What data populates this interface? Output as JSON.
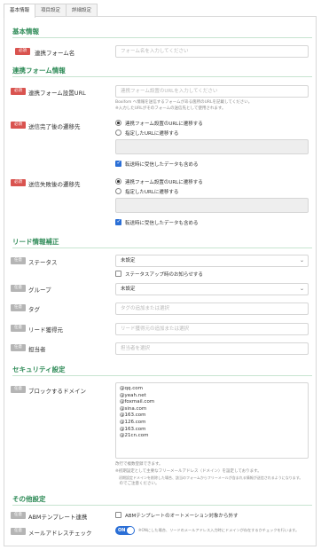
{
  "tabs": [
    "基本情報",
    "項目設定",
    "詳細設定"
  ],
  "badges": {
    "required": "必須",
    "optional": "任意"
  },
  "sections": {
    "basic": "基本情報",
    "destination": "連携フォーム情報",
    "lead": "リード情報補正",
    "security": "セキュリティ設定",
    "other": "その他設定"
  },
  "basic": {
    "form_name_label": "連携フォーム名",
    "form_name_placeholder": "フォーム名を入力してください"
  },
  "destination": {
    "url_label": "連携フォーム設置URL",
    "url_placeholder": "連携フォーム設置のURLを入力してください",
    "url_hint_1": "Boxifom へ情報を送信するフォームがある箇所のURLを記載してください。",
    "url_hint_2": "※入力したURLがそのフォームの送信先として使用されます。",
    "complete_label": "送信完了後の遷移先",
    "complete_opt1": "連携フォーム設置のURLに遷移する",
    "complete_opt2": "指定したURLに遷移する",
    "complete_check": "転送時に受信したデータも含める",
    "fail_label": "送信失敗後の遷移先",
    "fail_opt1": "連携フォーム設置のURLに遷移する",
    "fail_opt2": "指定したURLに遷移する",
    "fail_check": "転送時に受信したデータも含める"
  },
  "lead": {
    "status_label": "ステータス",
    "status_value": "未設定",
    "status_check": "ステータスアップ時のお知らせする",
    "group_label": "グループ",
    "group_value": "未設定",
    "tag_label": "タグ",
    "tag_placeholder": "タグの追加または選択",
    "source_label": "リード獲得元",
    "source_placeholder": "リード獲得元の追加または選択",
    "owner_label": "担当者",
    "owner_placeholder": "担当者を選択"
  },
  "security": {
    "block_label": "ブロックするドメイン",
    "domains": [
      "@qq.com",
      "@yeah.net",
      "@foxmail.com",
      "@sina.com",
      "@163.com",
      "@126.com",
      "@163.com",
      "@21cn.com"
    ],
    "hint_1": "改行で複数登録できます。",
    "hint_2": "※初期設定として主要なフリーメールアドレス（ドメイン）を設定しております。",
    "hint_3": "　初期設定ドメインを削除した場合、該当のフォームからフリーメールが含まれる情報が送信されるようになります。",
    "hint_4": "　のでご注意ください。"
  },
  "other": {
    "template_label": "ABMテンプレート連携",
    "template_check": "ABMテンプレートのオートメーション対象から外す",
    "mailcheck_label": "メールアドレスチェック",
    "toggle_text": "ON",
    "mailcheck_hint": "※ONにした場合、リードのメールアドレス入力時にドメインが存在するかチェックを行います。"
  },
  "colors": {
    "accent_green": "#2e8b57",
    "required_red": "#d9534f",
    "toggle_blue": "#2b6fd6"
  }
}
